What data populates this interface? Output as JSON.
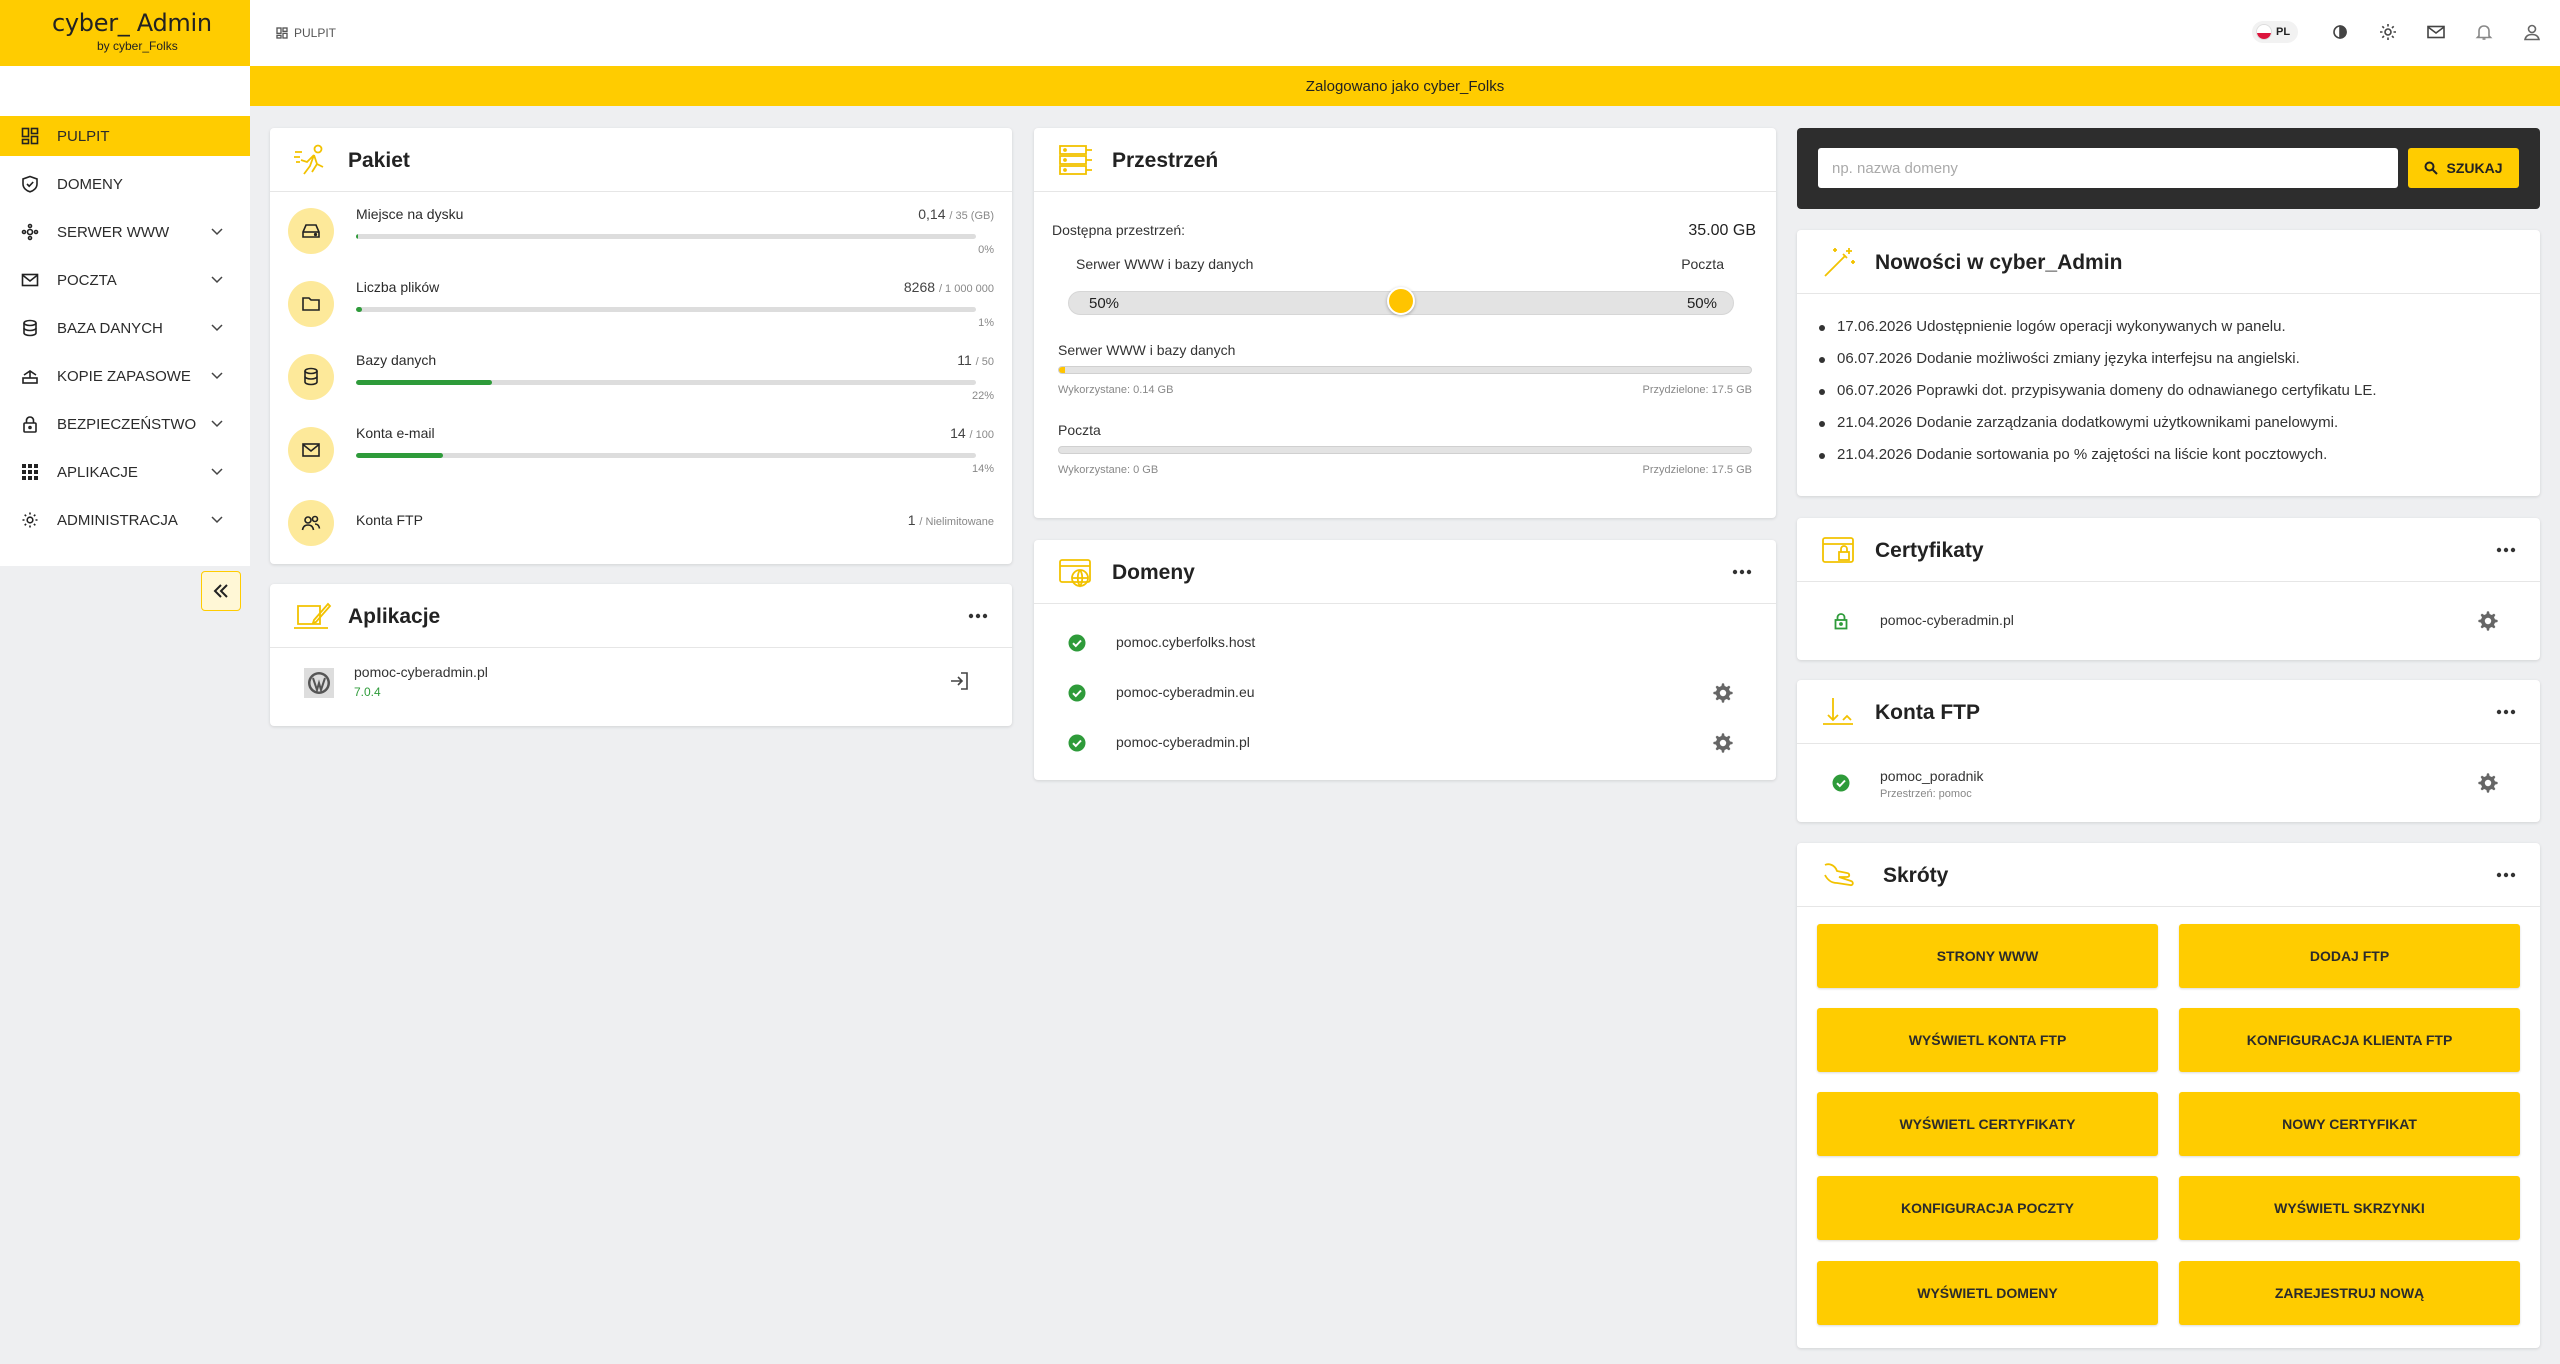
{
  "app": {
    "logo_title": "cyber_ Admin",
    "logo_sub": "by cyber_Folks"
  },
  "sidebar": {
    "items": [
      {
        "label": "PULPIT",
        "icon": "dashboard-icon"
      },
      {
        "label": "DOMENY",
        "icon": "shield-icon"
      },
      {
        "label": "SERWER WWW",
        "icon": "network-icon"
      },
      {
        "label": "POCZTA",
        "icon": "mail-icon"
      },
      {
        "label": "BAZA DANYCH",
        "icon": "database-icon"
      },
      {
        "label": "KOPIE ZAPASOWE",
        "icon": "backup-icon"
      },
      {
        "label": "BEZPIECZEŃSTWO",
        "icon": "lock-icon"
      },
      {
        "label": "APLIKACJE",
        "icon": "apps-grid-icon"
      },
      {
        "label": "ADMINISTRACJA",
        "icon": "gear-icon"
      }
    ]
  },
  "header": {
    "breadcrumb": "PULPIT",
    "lang": "PL"
  },
  "banner": {
    "text": "Zalogowano jako cyber_Folks"
  },
  "pakiet": {
    "title": "Pakiet",
    "rows": [
      {
        "label": "Miejsce na dysku",
        "value": "0,14",
        "limit": "/ 35 (GB)",
        "pct": "0%",
        "fill": 0.004
      },
      {
        "label": "Liczba plików",
        "value": "8268",
        "limit": "/ 1 000 000",
        "pct": "1%",
        "fill": 0.01
      },
      {
        "label": "Bazy danych",
        "value": "11",
        "limit": "/ 50",
        "pct": "22%",
        "fill": 0.22
      },
      {
        "label": "Konta e-mail",
        "value": "14",
        "limit": "/ 100",
        "pct": "14%",
        "fill": 0.14
      },
      {
        "label": "Konta FTP",
        "value": "1",
        "limit": "/ Nielimitowane"
      }
    ]
  },
  "aplikacje": {
    "title": "Aplikacje",
    "app_name": "pomoc-cyberadmin.pl",
    "app_version": "7.0.4"
  },
  "przestrzen": {
    "title": "Przestrzeń",
    "available_label": "Dostępna przestrzeń:",
    "available_value": "35.00 GB",
    "left_label": "Serwer WWW i bazy danych",
    "right_label": "Poczta",
    "left_pct": "50%",
    "right_pct": "50%",
    "split": 0.5,
    "www": {
      "label": "Serwer WWW i bazy danych",
      "used": "Wykorzystane: 0.14 GB",
      "assigned": "Przydzielone: 17.5 GB",
      "fill": 0.008
    },
    "mail": {
      "label": "Poczta",
      "used": "Wykorzystane: 0 GB",
      "assigned": "Przydzielone: 17.5 GB",
      "fill": 0
    }
  },
  "domeny": {
    "title": "Domeny",
    "items": [
      "pomoc.cyberfolks.host",
      "pomoc-cyberadmin.eu",
      "pomoc-cyberadmin.pl"
    ]
  },
  "search": {
    "placeholder": "np. nazwa domeny",
    "button": "SZUKAJ"
  },
  "nowosci": {
    "title": "Nowości w cyber_Admin",
    "items": [
      "17.06.2026 Udostępnienie logów operacji wykonywanych w panelu.",
      "06.07.2026 Dodanie możliwości zmiany języka interfejsu na angielski.",
      "06.07.2026 Poprawki dot. przypisywania domeny do odnawianego certyfikatu LE.",
      "21.04.2026 Dodanie zarządzania dodatkowymi użytkownikami panelowymi.",
      "21.04.2026 Dodanie sortowania po % zajętości na liście kont pocztowych."
    ]
  },
  "certyfikaty": {
    "title": "Certyfikaty",
    "item": "pomoc-cyberadmin.pl"
  },
  "ftp": {
    "title": "Konta FTP",
    "name": "pomoc_poradnik",
    "space": "Przestrzeń: pomoc"
  },
  "skroty": {
    "title": "Skróty",
    "buttons": [
      "STRONY WWW",
      "DODAJ FTP",
      "WYŚWIETL KONTA FTP",
      "KONFIGURACJA KLIENTA FTP",
      "WYŚWIETL CERTYFIKATY",
      "NOWY CERTYFIKAT",
      "KONFIGURACJA POCZTY",
      "WYŚWIETL SKRZYNKI",
      "WYŚWIETL DOMENY",
      "ZAREJESTRUJ NOWĄ"
    ]
  },
  "colors": {
    "accent": "#ffcc00",
    "success": "#2e9b3a",
    "dark": "#2d2d2d"
  }
}
